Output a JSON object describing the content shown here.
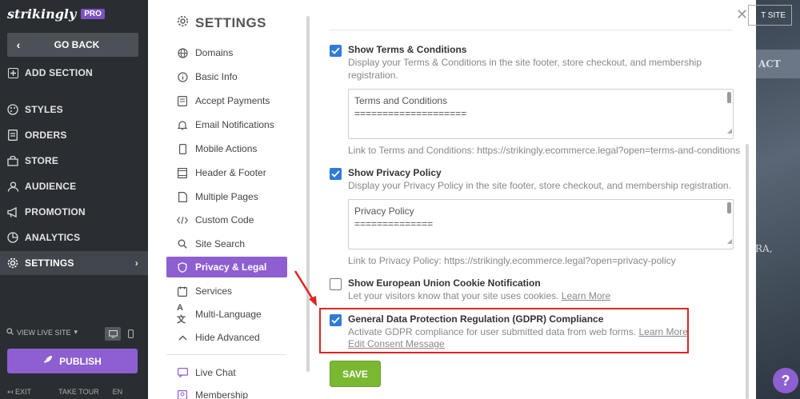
{
  "sidebar": {
    "brand": "strikingly",
    "badge": "PRO",
    "go_back": "GO BACK",
    "items": [
      {
        "label": "ADD SECTION",
        "icon": "plus-square-icon"
      },
      {
        "label": "STYLES",
        "icon": "palette-icon"
      },
      {
        "label": "ORDERS",
        "icon": "orders-icon"
      },
      {
        "label": "STORE",
        "icon": "store-icon"
      },
      {
        "label": "AUDIENCE",
        "icon": "audience-icon"
      },
      {
        "label": "PROMOTION",
        "icon": "megaphone-icon"
      },
      {
        "label": "ANALYTICS",
        "icon": "analytics-icon"
      },
      {
        "label": "SETTINGS",
        "icon": "gear-icon"
      }
    ],
    "view_live_site": "VIEW LIVE SITE",
    "publish": "PUBLISH",
    "bottom": {
      "exit": "EXIT",
      "take_tour": "TAKE TOUR",
      "lang": "EN"
    }
  },
  "settings": {
    "title": "SETTINGS",
    "nav": [
      {
        "label": "Domains",
        "icon": "globe-icon"
      },
      {
        "label": "Basic Info",
        "icon": "info-icon"
      },
      {
        "label": "Accept Payments",
        "icon": "payments-icon"
      },
      {
        "label": "Email Notifications",
        "icon": "bell-icon"
      },
      {
        "label": "Mobile Actions",
        "icon": "mobile-icon"
      },
      {
        "label": "Header & Footer",
        "icon": "header-footer-icon"
      },
      {
        "label": "Multiple Pages",
        "icon": "pages-icon"
      },
      {
        "label": "Custom Code",
        "icon": "code-icon"
      },
      {
        "label": "Site Search",
        "icon": "search-icon"
      },
      {
        "label": "Privacy & Legal",
        "icon": "shield-icon"
      },
      {
        "label": "Services",
        "icon": "services-icon"
      },
      {
        "label": "Multi-Language",
        "icon": "language-icon"
      },
      {
        "label": "Hide Advanced",
        "icon": "chevron-up-icon"
      },
      {
        "label": "Live Chat",
        "icon": "chat-icon"
      },
      {
        "label": "Membership",
        "icon": "membership-icon"
      }
    ]
  },
  "privacy": {
    "terms": {
      "title": "Show Terms & Conditions",
      "desc": "Display your Terms & Conditions in the site footer, store checkout, and membership registration.",
      "checked": true,
      "textarea_line1": "Terms and Conditions",
      "textarea_line2": "====================",
      "link_note": "Link to Terms and Conditions: https://strikingly.ecommerce.legal?open=terms-and-conditions"
    },
    "policy": {
      "title": "Show Privacy Policy",
      "desc": "Display your Privacy Policy in the site footer, store checkout, and membership registration.",
      "checked": true,
      "textarea_line1": "Privacy Policy",
      "textarea_line2": "==============",
      "link_note": "Link to Privacy Policy: https://strikingly.ecommerce.legal?open=privacy-policy"
    },
    "cookie": {
      "title": "Show European Union Cookie Notification",
      "desc": "Let your visitors know that your site uses cookies.",
      "learn_more": "Learn More",
      "checked": false
    },
    "gdpr": {
      "title": "General Data Protection Regulation (GDPR) Compliance",
      "desc": "Activate GDPR compliance for user submitted data from web forms.",
      "learn_more": "Learn More",
      "edit_consent": "Edit Consent Message",
      "checked": true
    },
    "save": "SAVE"
  },
  "site": {
    "top_button": "T SITE",
    "contact": "ACT",
    "text": "RA,"
  },
  "help": "?"
}
